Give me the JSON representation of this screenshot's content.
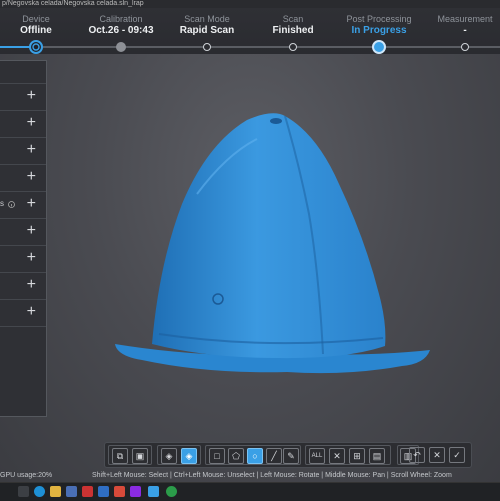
{
  "window": {
    "title": "p/Negovska celada/Negovska celada.sln_lrap"
  },
  "workflow": [
    {
      "label": "Device",
      "value": "Offline",
      "state": "done"
    },
    {
      "label": "Calibration",
      "value": "Oct.26 - 09:43",
      "state": "gray"
    },
    {
      "label": "Scan Mode",
      "value": "Rapid Scan",
      "state": "normal"
    },
    {
      "label": "Scan",
      "value": "Finished",
      "state": "normal"
    },
    {
      "label": "Post Processing",
      "value": "In Progress",
      "state": "current"
    },
    {
      "label": "Measurement",
      "value": "-",
      "state": "normal"
    }
  ],
  "panel": {
    "row_suffix": "s",
    "plus": "+",
    "row_count": 9
  },
  "status": {
    "gpu_usage": "GPU usage:20%",
    "mouse_hints": "Shift+Left Mouse: Select | Ctrl+Left Mouse: Unselect | Left Mouse: Rotate | Middle Mouse: Pan | Scroll Wheel: Zoom"
  },
  "toolbar": {
    "all_label": "ALL"
  },
  "colors": {
    "accent": "#3aa0e6",
    "model": "#2f8fd6",
    "background": "#4a4b51"
  }
}
